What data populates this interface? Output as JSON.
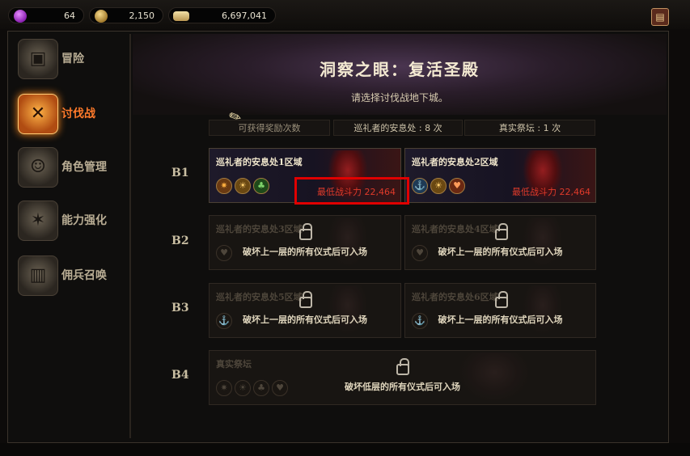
{
  "resources": [
    {
      "icon": "purple-gem-icon",
      "value": "64"
    },
    {
      "icon": "gold-coin-icon",
      "value": "2,150"
    },
    {
      "icon": "gold-bar-icon",
      "value": "6,697,041"
    }
  ],
  "sidebar": {
    "items": [
      {
        "label": "冒险",
        "icon": "book-icon",
        "active": false
      },
      {
        "label": "讨伐战",
        "icon": "crossed-swords-icon",
        "active": true
      },
      {
        "label": "角色管理",
        "icon": "character-icon",
        "active": false
      },
      {
        "label": "能力强化",
        "icon": "shuriken-icon",
        "active": false
      },
      {
        "label": "佣兵召唤",
        "icon": "chest-icon",
        "active": false
      }
    ]
  },
  "header": {
    "title": "洞察之眼：复活圣殿",
    "subtitle": "请选择讨伐战地下城。"
  },
  "info": {
    "reward_count": "可获得奖励次数",
    "pilgrim_rest": "巡礼者的安息处 : 8 次",
    "true_altar": "真实祭坛 : 1 次"
  },
  "floors": [
    "B1",
    "B2",
    "B3",
    "B4"
  ],
  "cards": {
    "b1_1": {
      "name": "巡礼者的安息处1区域",
      "power": "最低战斗力 22,464"
    },
    "b1_2": {
      "name": "巡礼者的安息处2区域",
      "power": "最低战斗力 22,464"
    },
    "b2_1": {
      "name": "巡礼者的安息处3区域",
      "lock_msg": "破坏上一层的所有仪式后可入场"
    },
    "b2_2": {
      "name": "巡礼者的安息处4区域",
      "lock_msg": "破坏上一层的所有仪式后可入场"
    },
    "b3_1": {
      "name": "巡礼者的安息处5区域",
      "lock_msg": "破坏上一层的所有仪式后可入场"
    },
    "b3_2": {
      "name": "巡礼者的安息处6区域",
      "lock_msg": "破坏上一层的所有仪式后可入场"
    },
    "b4": {
      "name": "真实祭坛",
      "lock_msg": "破坏低层的所有仪式后可入场"
    }
  },
  "colors": {
    "accent_orange": "#ff7a2a",
    "power_red": "#e03a2a",
    "highlight_red": "#e00000"
  }
}
